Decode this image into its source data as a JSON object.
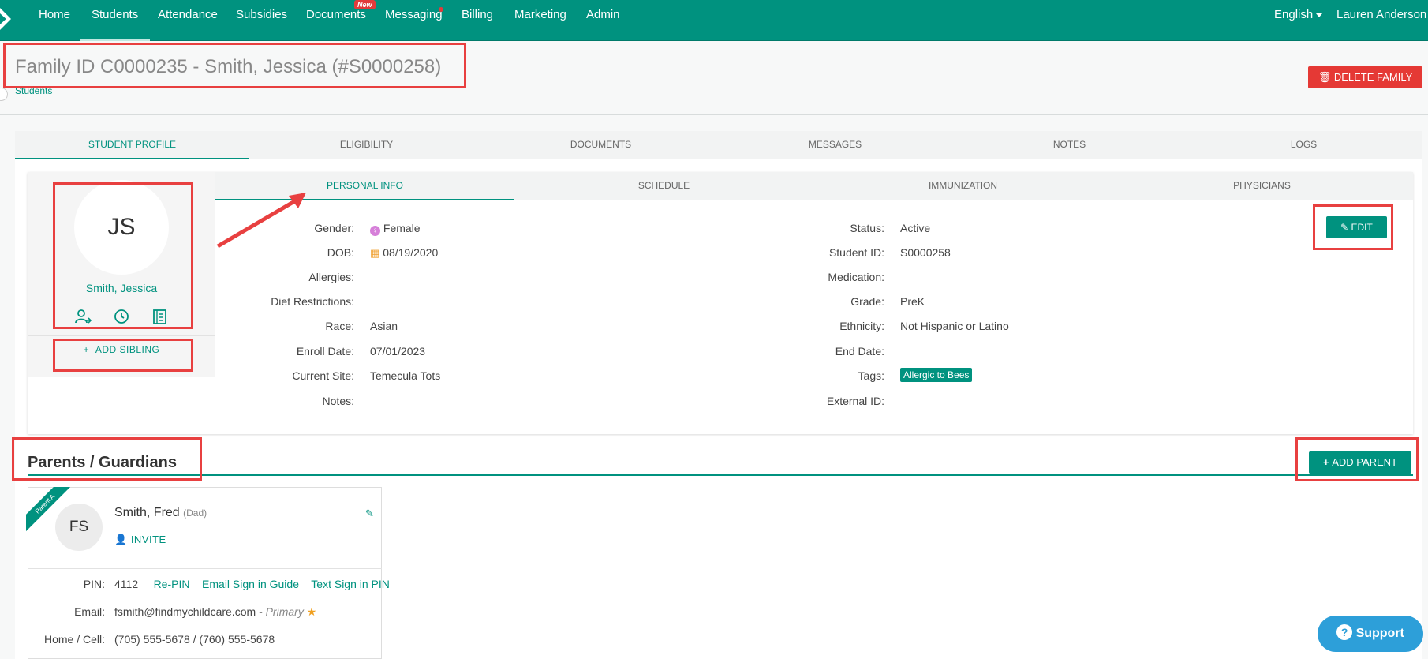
{
  "nav": {
    "items": [
      "Home",
      "Students",
      "Attendance",
      "Subsidies",
      "Documents",
      "Messaging",
      "Billing",
      "Marketing",
      "Admin"
    ],
    "new_badge": "New",
    "language": "English",
    "user": "Lauren Anderson"
  },
  "header": {
    "title": "Family ID C0000235 - Smith, Jessica (#S0000258)",
    "breadcrumb": "Students",
    "delete_label": "DELETE FAMILY"
  },
  "main_tabs": [
    "STUDENT PROFILE",
    "ELIGIBILITY",
    "DOCUMENTS",
    "MESSAGES",
    "NOTES",
    "LOGS"
  ],
  "student": {
    "initials": "JS",
    "name": "Smith, Jessica",
    "add_sibling": "ADD SIBLING",
    "icons": [
      "person-transfer-icon",
      "clock-icon",
      "ledger-icon"
    ]
  },
  "sub_tabs": [
    "PERSONAL INFO",
    "SCHEDULE",
    "IMMUNIZATION",
    "PHYSICIANS"
  ],
  "personal": {
    "edit_label": "EDIT",
    "left": [
      {
        "label": "Gender:",
        "value": "Female"
      },
      {
        "label": "DOB:",
        "value": "08/19/2020"
      },
      {
        "label": "Allergies:",
        "value": ""
      },
      {
        "label": "Diet Restrictions:",
        "value": ""
      },
      {
        "label": "Race:",
        "value": "Asian"
      },
      {
        "label": "Enroll Date:",
        "value": "07/01/2023"
      },
      {
        "label": "Current Site:",
        "value": "Temecula Tots"
      },
      {
        "label": "Notes:",
        "value": ""
      }
    ],
    "right": [
      {
        "label": "Status:",
        "value": "Active"
      },
      {
        "label": "Student ID:",
        "value": "S0000258"
      },
      {
        "label": "Medication:",
        "value": ""
      },
      {
        "label": "Grade:",
        "value": "PreK"
      },
      {
        "label": "Ethnicity:",
        "value": "Not Hispanic or Latino"
      },
      {
        "label": "End Date:",
        "value": ""
      },
      {
        "label": "Tags:",
        "value": "Allergic to Bees"
      },
      {
        "label": "External ID:",
        "value": ""
      }
    ]
  },
  "parents": {
    "title": "Parents / Guardians",
    "add_label": "ADD PARENT",
    "card": {
      "ribbon": "Parent A",
      "initials": "FS",
      "name": "Smith, Fred",
      "relation": "(Dad)",
      "invite": "INVITE",
      "pin_label": "PIN:",
      "pin": "4112",
      "repin": "Re-PIN",
      "email_guide": "Email Sign in Guide",
      "text_pin": "Text Sign in PIN",
      "email_label": "Email:",
      "email": "fsmith@findmychildcare.com",
      "primary": "- Primary",
      "phone_label": "Home / Cell:",
      "phone": "(705) 555-5678 / (760) 555-5678"
    }
  },
  "support_label": "Support",
  "colors": {
    "accent": "#00927f",
    "danger": "#e53935",
    "annotation": "#e84040",
    "support": "#2d9fd9"
  }
}
